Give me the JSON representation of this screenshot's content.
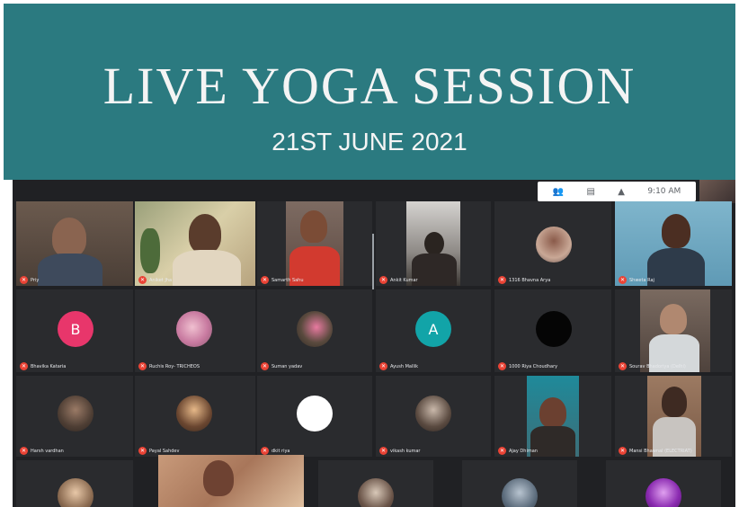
{
  "banner": {
    "title": "LIVE YOGA SESSION",
    "date": "21ST JUNE 2021"
  },
  "toolbar": {
    "people_icon": "people-icon",
    "chat_icon": "chat-icon",
    "activities_icon": "activities-icon",
    "time": "9:10 AM"
  },
  "colors": {
    "banner": "#2b7a80",
    "meet_bg": "#202124",
    "tile_bg": "#2a2b2e",
    "mic_off": "#ea4335"
  },
  "participants": {
    "row1": [
      {
        "name": "Priy"
      },
      {
        "name": "Aniket Jha"
      },
      {
        "name": "Samarth Sahu"
      },
      {
        "name": "Ankit Kumar"
      },
      {
        "name": "1316 Bhavna Arya"
      },
      {
        "name": "Shweta Raj"
      }
    ],
    "row2": [
      {
        "name": "Bhavika Kataria",
        "initial": "B"
      },
      {
        "name": "Ruchis Roy- TRICHEOS"
      },
      {
        "name": "Suman yadav"
      },
      {
        "name": "Ayush Mallik",
        "initial": "A"
      },
      {
        "name": "1000 Riya Choudhary"
      },
      {
        "name": "Sourav Bhadoriya (Delhi)"
      }
    ],
    "row3": [
      {
        "name": "Harsh vardhan"
      },
      {
        "name": "Payal Sahdev"
      },
      {
        "name": "dkit riya"
      },
      {
        "name": "vikash kumar"
      },
      {
        "name": "Ajay Dhiman"
      },
      {
        "name": "Mansi Bhawnal (ELECTRIAT)"
      }
    ]
  }
}
